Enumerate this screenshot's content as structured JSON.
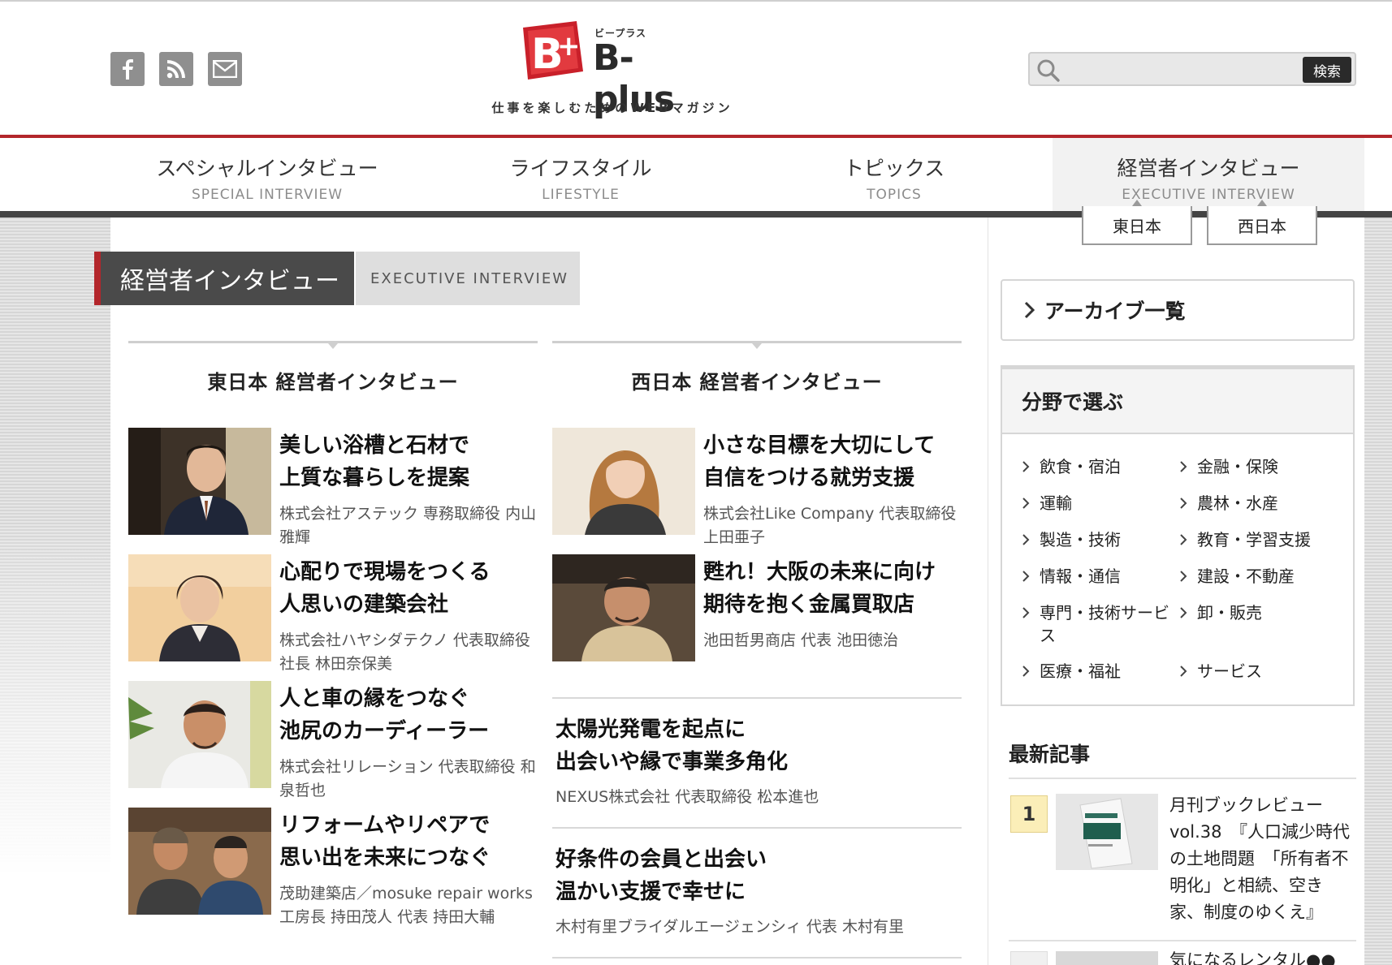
{
  "header": {
    "logo_ruby": "ビープラス",
    "logo_text": "B-plus",
    "tagline": "仕事を楽しむためのWEBマガジン",
    "social": [
      "facebook-icon",
      "rss-icon",
      "mail-icon"
    ],
    "search": {
      "placeholder": "",
      "button_label": "検索"
    }
  },
  "nav": {
    "items": [
      {
        "jp": "スペシャルインタビュー",
        "en": "SPECIAL INTERVIEW"
      },
      {
        "jp": "ライフスタイル",
        "en": "LIFESTYLE"
      },
      {
        "jp": "トピックス",
        "en": "TOPICS"
      },
      {
        "jp": "経営者インタビュー",
        "en": "EXECUTIVE INTERVIEW"
      }
    ],
    "subnav": [
      "東日本",
      "西日本"
    ]
  },
  "section": {
    "jp": "経営者インタビュー",
    "en": "EXECUTIVE INTERVIEW"
  },
  "east": {
    "title": "東日本 経営者インタビュー",
    "cards": [
      {
        "title1": "美しい浴槽と石材で",
        "title2": "上質な暮らしを提案",
        "sub": "株式会社アステック 専務取締役 内山雅輝"
      },
      {
        "title1": "心配りで現場をつくる",
        "title2": "人思いの建築会社",
        "sub": "株式会社ハヤシダテクノ 代表取締役社長 林田奈保美"
      },
      {
        "title1": "人と車の縁をつなぐ",
        "title2": "池尻のカーディーラー",
        "sub": "株式会社リレーション 代表取締役 和泉哲也"
      },
      {
        "title1": "リフォームやリペアで",
        "title2": "思い出を未来につなぐ",
        "sub": "茂助建築店／mosuke repair works 工房長 持田茂人 代表 持田大輔"
      }
    ]
  },
  "west": {
    "title": "西日本 経営者インタビュー",
    "cards": [
      {
        "title1": "小さな目標を大切にして",
        "title2": "自信をつける就労支援",
        "sub": "株式会社Like Company 代表取締役 上田亜子"
      },
      {
        "title1": "甦れ！大阪の未来に向け",
        "title2": "期待を抱く金属買取店",
        "sub": "池田哲男商店 代表 池田徳治"
      }
    ],
    "text_cards": [
      {
        "title1": "太陽光発電を起点に",
        "title2": "出会いや縁で事業多角化",
        "sub": "NEXUS株式会社 代表取締役 松本進也"
      },
      {
        "title1": "好条件の会員と出会い",
        "title2": "温かい支援で幸せに",
        "sub": "木村有里ブライダルエージェンシィ 代表 木村有里"
      }
    ]
  },
  "sidebar": {
    "archive_label": "アーカイブ一覧",
    "genre_title": "分野で選ぶ",
    "genres": [
      "飲食・宿泊",
      "金融・保険",
      "運輸",
      "農林・水産",
      "製造・技術",
      "教育・学習支援",
      "情報・通信",
      "建設・不動産",
      "専門・技術サービス",
      "卸・販売",
      "医療・福祉",
      "サービス"
    ],
    "latest_title": "最新記事",
    "latest": [
      {
        "rank": "1",
        "text": "月刊ブックレビュー vol.38　『人口減少時代の土地問題　「所有者不明化」と相続、空き家、制度のゆくえ』"
      },
      {
        "rank": "",
        "text": "気になるレンタル●●"
      }
    ]
  }
}
